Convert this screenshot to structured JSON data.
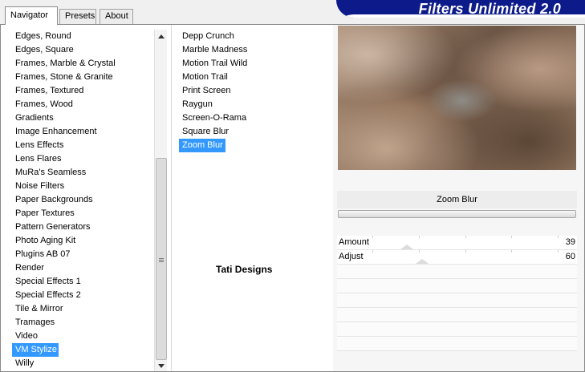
{
  "tabs": [
    {
      "label": "Navigator",
      "active": true
    },
    {
      "label": "Presets",
      "active": false
    },
    {
      "label": "About",
      "active": false
    }
  ],
  "brand": {
    "title": "Filters Unlimited 2.0",
    "color": "#0c1a8a"
  },
  "categories": {
    "items": [
      "Edges, Round",
      "Edges, Square",
      "Frames, Marble & Crystal",
      "Frames, Stone & Granite",
      "Frames, Textured",
      "Frames, Wood",
      "Gradients",
      "Image Enhancement",
      "Lens Effects",
      "Lens Flares",
      "MuRa's Seamless",
      "Noise Filters",
      "Paper Backgrounds",
      "Paper Textures",
      "Pattern Generators",
      "Photo Aging Kit",
      "Plugins AB 07",
      "Render",
      "Special Effects 1",
      "Special Effects 2",
      "Tile & Mirror",
      "Tramages",
      "Video",
      "VM Stylize",
      "Willy"
    ],
    "selected": "VM Stylize",
    "selection_color": "#3399ff"
  },
  "filters": {
    "items": [
      "Depp Crunch",
      "Marble Madness",
      "Motion Trail Wild",
      "Motion Trail",
      "Print Screen",
      "Raygun",
      "Screen-O-Rama",
      "Square Blur",
      "Zoom Blur"
    ],
    "selected": "Zoom Blur",
    "author": "Tati Designs"
  },
  "preview": {
    "filter_name": "Zoom Blur"
  },
  "params": [
    {
      "name": "Amount",
      "value": "39",
      "level": 0.153
    },
    {
      "name": "Adjust",
      "value": "60",
      "level": 0.235
    }
  ],
  "empty_param_rows": 6
}
